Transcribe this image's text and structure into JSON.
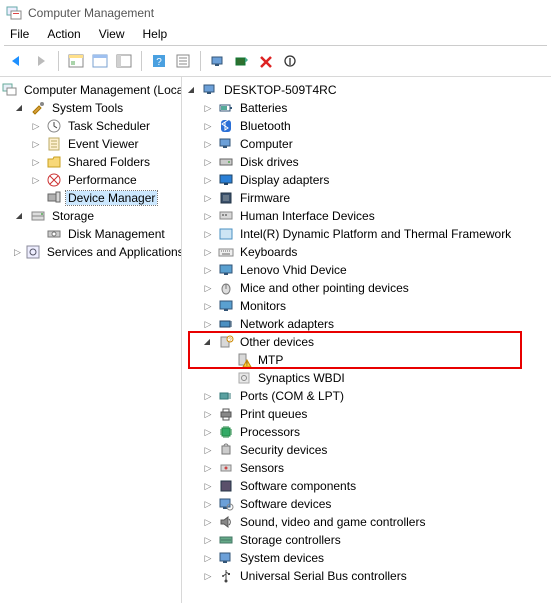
{
  "window": {
    "title": "Computer Management"
  },
  "menu": {
    "file": "File",
    "action": "Action",
    "view": "View",
    "help": "Help"
  },
  "left_tree": {
    "root": "Computer Management (Local",
    "system_tools": "System Tools",
    "task_scheduler": "Task Scheduler",
    "event_viewer": "Event Viewer",
    "shared_folders": "Shared Folders",
    "performance": "Performance",
    "device_manager": "Device Manager",
    "storage": "Storage",
    "disk_management": "Disk Management",
    "services_apps": "Services and Applications"
  },
  "right_tree": {
    "root": "DESKTOP-509T4RC",
    "items": [
      "Batteries",
      "Bluetooth",
      "Computer",
      "Disk drives",
      "Display adapters",
      "Firmware",
      "Human Interface Devices",
      "Intel(R) Dynamic Platform and Thermal Framework",
      "Keyboards",
      "Lenovo Vhid Device",
      "Mice and other pointing devices",
      "Monitors",
      "Network adapters",
      "Other devices",
      "MTP",
      "Synaptics WBDI",
      "Ports (COM & LPT)",
      "Print queues",
      "Processors",
      "Security devices",
      "Sensors",
      "Software components",
      "Software devices",
      "Sound, video and game controllers",
      "Storage controllers",
      "System devices",
      "Universal Serial Bus controllers"
    ]
  }
}
